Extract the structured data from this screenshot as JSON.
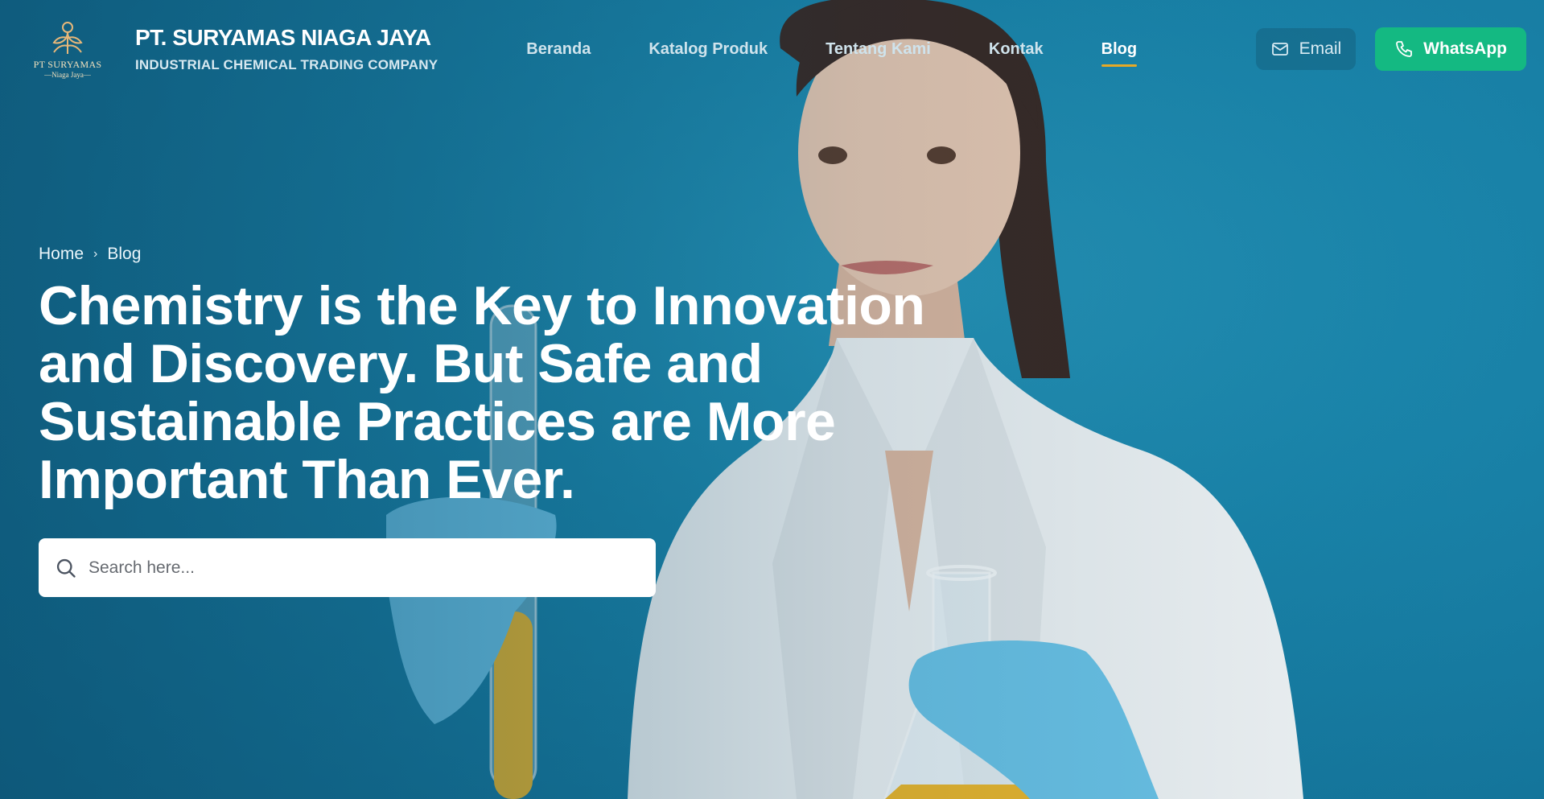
{
  "brand": {
    "logo_name": "PT SURYAMAS",
    "logo_sub": "—Niaga Jaya—",
    "title": "PT. SURYAMAS NIAGA JAYA",
    "tagline": "INDUSTRIAL CHEMICAL TRADING COMPANY"
  },
  "nav": {
    "items": [
      {
        "label": "Beranda"
      },
      {
        "label": "Katalog Produk"
      },
      {
        "label": "Tentang Kami"
      },
      {
        "label": "Kontak"
      },
      {
        "label": "Blog"
      }
    ],
    "active": "Blog"
  },
  "actions": {
    "email_label": "Email",
    "email_icon": "mail-icon",
    "whatsapp_label": "WhatsApp",
    "whatsapp_icon": "phone-icon"
  },
  "breadcrumb": {
    "home": "Home",
    "current": "Blog"
  },
  "hero": {
    "headline": "Chemistry is the Key to Innovation and Discovery. But Safe and Sustainable Practices are More Important Than Ever."
  },
  "search": {
    "placeholder": "Search here...",
    "icon": "search-icon"
  },
  "colors": {
    "hero_background": "#1b7ea3",
    "whatsapp_button": "#14b982",
    "active_nav_underline": "#e6a927"
  }
}
